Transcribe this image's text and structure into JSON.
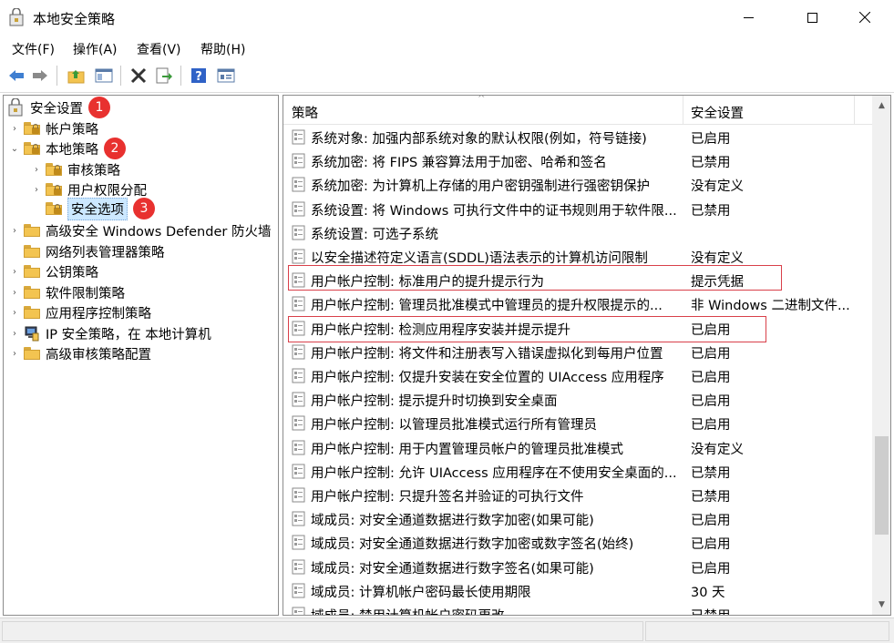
{
  "window": {
    "title": "本地安全策略",
    "app_icon": "security-policy-icon"
  },
  "menu": [
    {
      "label": "文件(F)"
    },
    {
      "label": "操作(A)"
    },
    {
      "label": "查看(V)"
    },
    {
      "label": "帮助(H)"
    }
  ],
  "toolbar": {
    "buttons": [
      "back-arrow-icon",
      "forward-arrow-icon",
      "up-folder-icon",
      "show-hide-tree-icon",
      "delete-icon",
      "export-list-icon",
      "help-icon",
      "properties-icon"
    ]
  },
  "tree": {
    "items": [
      {
        "label": "安全设置",
        "badge": "1"
      },
      {
        "label": "帐户策略"
      },
      {
        "label": "本地策略",
        "badge": "2"
      },
      {
        "label": "审核策略"
      },
      {
        "label": "用户权限分配"
      },
      {
        "label": "安全选项",
        "badge": "3"
      },
      {
        "label": "高级安全 Windows Defender 防火墙"
      },
      {
        "label": "网络列表管理器策略"
      },
      {
        "label": "公钥策略"
      },
      {
        "label": "软件限制策略"
      },
      {
        "label": "应用程序控制策略"
      },
      {
        "label": "IP 安全策略，在 本地计算机"
      },
      {
        "label": "高级审核策略配置"
      }
    ]
  },
  "list": {
    "columns": {
      "policy": "策略",
      "setting": "安全设置"
    },
    "rows": [
      {
        "policy": "系统对象: 加强内部系统对象的默认权限(例如，符号链接)",
        "setting": "已启用"
      },
      {
        "policy": "系统加密: 将 FIPS 兼容算法用于加密、哈希和签名",
        "setting": "已禁用"
      },
      {
        "policy": "系统加密: 为计算机上存储的用户密钥强制进行强密钥保护",
        "setting": "没有定义"
      },
      {
        "policy": "系统设置: 将 Windows 可执行文件中的证书规则用于软件限...",
        "setting": "已禁用"
      },
      {
        "policy": "系统设置: 可选子系统",
        "setting": ""
      },
      {
        "policy": "以安全描述符定义语言(SDDL)语法表示的计算机访问限制",
        "setting": "没有定义"
      },
      {
        "policy": "用户帐户控制: 标准用户的提升提示行为",
        "setting": "提示凭据"
      },
      {
        "policy": "用户帐户控制: 管理员批准模式中管理员的提升权限提示的...",
        "setting": "非 Windows 二进制文件..."
      },
      {
        "policy": "用户帐户控制: 检测应用程序安装并提示提升",
        "setting": "已启用"
      },
      {
        "policy": "用户帐户控制: 将文件和注册表写入错误虚拟化到每用户位置",
        "setting": "已启用"
      },
      {
        "policy": "用户帐户控制: 仅提升安装在安全位置的 UIAccess 应用程序",
        "setting": "已启用"
      },
      {
        "policy": "用户帐户控制: 提示提升时切换到安全桌面",
        "setting": "已启用"
      },
      {
        "policy": "用户帐户控制: 以管理员批准模式运行所有管理员",
        "setting": "已启用"
      },
      {
        "policy": "用户帐户控制: 用于内置管理员帐户的管理员批准模式",
        "setting": "没有定义"
      },
      {
        "policy": "用户帐户控制: 允许 UIAccess 应用程序在不使用安全桌面的...",
        "setting": "已禁用"
      },
      {
        "policy": "用户帐户控制: 只提升签名并验证的可执行文件",
        "setting": "已禁用"
      },
      {
        "policy": "域成员: 对安全通道数据进行数字加密(如果可能)",
        "setting": "已启用"
      },
      {
        "policy": "域成员: 对安全通道数据进行数字加密或数字签名(始终)",
        "setting": "已启用"
      },
      {
        "policy": "域成员: 对安全通道数据进行数字签名(如果可能)",
        "setting": "已启用"
      },
      {
        "policy": "域成员: 计算机帐户密码最长使用期限",
        "setting": "30 天"
      },
      {
        "policy": "域成员: 禁用计算机帐户密码更改",
        "setting": "已禁用"
      }
    ]
  },
  "colors": {
    "badge": "#e8312f",
    "highlight": "#d9404a",
    "selection": "#cce8ff"
  }
}
